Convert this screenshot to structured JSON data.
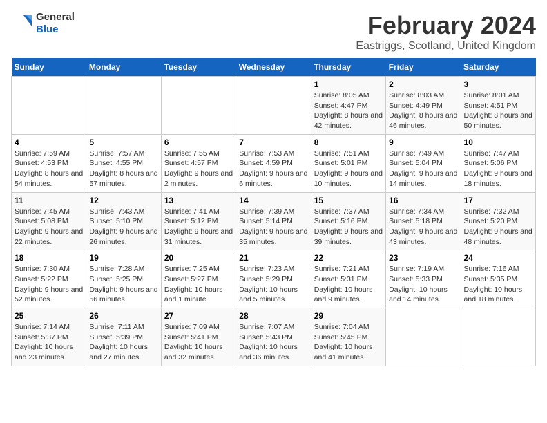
{
  "logo": {
    "general": "General",
    "blue": "Blue"
  },
  "title": "February 2024",
  "subtitle": "Eastriggs, Scotland, United Kingdom",
  "days_of_week": [
    "Sunday",
    "Monday",
    "Tuesday",
    "Wednesday",
    "Thursday",
    "Friday",
    "Saturday"
  ],
  "weeks": [
    [
      {
        "day": "",
        "sunrise": "",
        "sunset": "",
        "daylight": ""
      },
      {
        "day": "",
        "sunrise": "",
        "sunset": "",
        "daylight": ""
      },
      {
        "day": "",
        "sunrise": "",
        "sunset": "",
        "daylight": ""
      },
      {
        "day": "",
        "sunrise": "",
        "sunset": "",
        "daylight": ""
      },
      {
        "day": "1",
        "sunrise": "Sunrise: 8:05 AM",
        "sunset": "Sunset: 4:47 PM",
        "daylight": "Daylight: 8 hours and 42 minutes."
      },
      {
        "day": "2",
        "sunrise": "Sunrise: 8:03 AM",
        "sunset": "Sunset: 4:49 PM",
        "daylight": "Daylight: 8 hours and 46 minutes."
      },
      {
        "day": "3",
        "sunrise": "Sunrise: 8:01 AM",
        "sunset": "Sunset: 4:51 PM",
        "daylight": "Daylight: 8 hours and 50 minutes."
      }
    ],
    [
      {
        "day": "4",
        "sunrise": "Sunrise: 7:59 AM",
        "sunset": "Sunset: 4:53 PM",
        "daylight": "Daylight: 8 hours and 54 minutes."
      },
      {
        "day": "5",
        "sunrise": "Sunrise: 7:57 AM",
        "sunset": "Sunset: 4:55 PM",
        "daylight": "Daylight: 8 hours and 57 minutes."
      },
      {
        "day": "6",
        "sunrise": "Sunrise: 7:55 AM",
        "sunset": "Sunset: 4:57 PM",
        "daylight": "Daylight: 9 hours and 2 minutes."
      },
      {
        "day": "7",
        "sunrise": "Sunrise: 7:53 AM",
        "sunset": "Sunset: 4:59 PM",
        "daylight": "Daylight: 9 hours and 6 minutes."
      },
      {
        "day": "8",
        "sunrise": "Sunrise: 7:51 AM",
        "sunset": "Sunset: 5:01 PM",
        "daylight": "Daylight: 9 hours and 10 minutes."
      },
      {
        "day": "9",
        "sunrise": "Sunrise: 7:49 AM",
        "sunset": "Sunset: 5:04 PM",
        "daylight": "Daylight: 9 hours and 14 minutes."
      },
      {
        "day": "10",
        "sunrise": "Sunrise: 7:47 AM",
        "sunset": "Sunset: 5:06 PM",
        "daylight": "Daylight: 9 hours and 18 minutes."
      }
    ],
    [
      {
        "day": "11",
        "sunrise": "Sunrise: 7:45 AM",
        "sunset": "Sunset: 5:08 PM",
        "daylight": "Daylight: 9 hours and 22 minutes."
      },
      {
        "day": "12",
        "sunrise": "Sunrise: 7:43 AM",
        "sunset": "Sunset: 5:10 PM",
        "daylight": "Daylight: 9 hours and 26 minutes."
      },
      {
        "day": "13",
        "sunrise": "Sunrise: 7:41 AM",
        "sunset": "Sunset: 5:12 PM",
        "daylight": "Daylight: 9 hours and 31 minutes."
      },
      {
        "day": "14",
        "sunrise": "Sunrise: 7:39 AM",
        "sunset": "Sunset: 5:14 PM",
        "daylight": "Daylight: 9 hours and 35 minutes."
      },
      {
        "day": "15",
        "sunrise": "Sunrise: 7:37 AM",
        "sunset": "Sunset: 5:16 PM",
        "daylight": "Daylight: 9 hours and 39 minutes."
      },
      {
        "day": "16",
        "sunrise": "Sunrise: 7:34 AM",
        "sunset": "Sunset: 5:18 PM",
        "daylight": "Daylight: 9 hours and 43 minutes."
      },
      {
        "day": "17",
        "sunrise": "Sunrise: 7:32 AM",
        "sunset": "Sunset: 5:20 PM",
        "daylight": "Daylight: 9 hours and 48 minutes."
      }
    ],
    [
      {
        "day": "18",
        "sunrise": "Sunrise: 7:30 AM",
        "sunset": "Sunset: 5:22 PM",
        "daylight": "Daylight: 9 hours and 52 minutes."
      },
      {
        "day": "19",
        "sunrise": "Sunrise: 7:28 AM",
        "sunset": "Sunset: 5:25 PM",
        "daylight": "Daylight: 9 hours and 56 minutes."
      },
      {
        "day": "20",
        "sunrise": "Sunrise: 7:25 AM",
        "sunset": "Sunset: 5:27 PM",
        "daylight": "Daylight: 10 hours and 1 minute."
      },
      {
        "day": "21",
        "sunrise": "Sunrise: 7:23 AM",
        "sunset": "Sunset: 5:29 PM",
        "daylight": "Daylight: 10 hours and 5 minutes."
      },
      {
        "day": "22",
        "sunrise": "Sunrise: 7:21 AM",
        "sunset": "Sunset: 5:31 PM",
        "daylight": "Daylight: 10 hours and 9 minutes."
      },
      {
        "day": "23",
        "sunrise": "Sunrise: 7:19 AM",
        "sunset": "Sunset: 5:33 PM",
        "daylight": "Daylight: 10 hours and 14 minutes."
      },
      {
        "day": "24",
        "sunrise": "Sunrise: 7:16 AM",
        "sunset": "Sunset: 5:35 PM",
        "daylight": "Daylight: 10 hours and 18 minutes."
      }
    ],
    [
      {
        "day": "25",
        "sunrise": "Sunrise: 7:14 AM",
        "sunset": "Sunset: 5:37 PM",
        "daylight": "Daylight: 10 hours and 23 minutes."
      },
      {
        "day": "26",
        "sunrise": "Sunrise: 7:11 AM",
        "sunset": "Sunset: 5:39 PM",
        "daylight": "Daylight: 10 hours and 27 minutes."
      },
      {
        "day": "27",
        "sunrise": "Sunrise: 7:09 AM",
        "sunset": "Sunset: 5:41 PM",
        "daylight": "Daylight: 10 hours and 32 minutes."
      },
      {
        "day": "28",
        "sunrise": "Sunrise: 7:07 AM",
        "sunset": "Sunset: 5:43 PM",
        "daylight": "Daylight: 10 hours and 36 minutes."
      },
      {
        "day": "29",
        "sunrise": "Sunrise: 7:04 AM",
        "sunset": "Sunset: 5:45 PM",
        "daylight": "Daylight: 10 hours and 41 minutes."
      },
      {
        "day": "",
        "sunrise": "",
        "sunset": "",
        "daylight": ""
      },
      {
        "day": "",
        "sunrise": "",
        "sunset": "",
        "daylight": ""
      }
    ]
  ]
}
